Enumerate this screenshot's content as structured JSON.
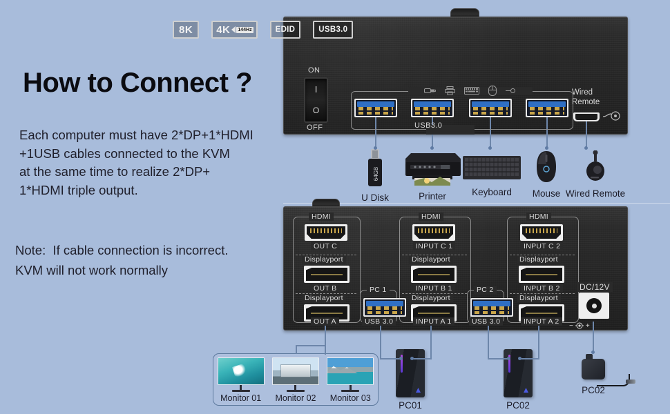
{
  "page": {
    "headline": "How to Connect ?",
    "body": "Each computer must have 2*DP+1*HDMI +1USB cables connected to the KVM at the same time to realize 2*DP+ 1*HDMI triple output.",
    "note": "Note:  If cable connection is incorrect. KVM will not work normally",
    "background_color": "#a8bcdb",
    "text_color": "#20202c"
  },
  "front_panel": {
    "badges": [
      {
        "id": "badge-8k",
        "label": "8K"
      },
      {
        "id": "badge-4k",
        "label": "4K",
        "sub_label": "144Hz"
      },
      {
        "id": "badge-edid",
        "label": "EDID"
      },
      {
        "id": "badge-usb3",
        "label": "USB3.0"
      }
    ],
    "power_switch": {
      "on_label": "ON",
      "off_label": "OFF",
      "on_mark": "I",
      "off_mark": "O"
    },
    "usb_group_label": "USB3.0",
    "usb_ports": [
      {
        "id": "usb-port-1",
        "name": "usb-port-u-disk"
      },
      {
        "id": "usb-port-2",
        "name": "usb-port-printer"
      },
      {
        "id": "usb-port-3",
        "name": "usb-port-keyboard"
      },
      {
        "id": "usb-port-4",
        "name": "usb-port-mouse"
      }
    ],
    "device_icons": [
      "usb-stick-icon",
      "printer-icon",
      "keyboard-icon",
      "mouse-icon"
    ],
    "wired_remote_label": "Wired\nRemote",
    "wired_remote_line1": "Wired",
    "wired_remote_line2": "Remote"
  },
  "rear_panel": {
    "groups": [
      {
        "id": "group-outputs",
        "ports": [
          {
            "type_label": "HDMI",
            "name_label": "OUT C",
            "kind": "hdmi"
          },
          {
            "type_label": "Displayport",
            "name_label": "OUT B",
            "kind": "dp"
          },
          {
            "type_label": "Displayport",
            "name_label": "OUT A",
            "kind": "dp"
          }
        ]
      },
      {
        "id": "group-pc1",
        "pc_label": "PC 1",
        "usb_label": "USB 3.0",
        "ports": [
          {
            "type_label": "HDMI",
            "name_label": "INPUT C 1",
            "kind": "hdmi"
          },
          {
            "type_label": "Displayport",
            "name_label": "INPUT B 1",
            "kind": "dp"
          },
          {
            "type_label": "Displayport",
            "name_label": "INPUT A 1",
            "kind": "dp"
          }
        ]
      },
      {
        "id": "group-pc2",
        "pc_label": "PC 2",
        "usb_label": "USB 3.0",
        "ports": [
          {
            "type_label": "HDMI",
            "name_label": "INPUT C 2",
            "kind": "hdmi"
          },
          {
            "type_label": "Displayport",
            "name_label": "INPUT B 2",
            "kind": "dp"
          },
          {
            "type_label": "Displayport",
            "name_label": "INPUT A 2",
            "kind": "dp"
          }
        ]
      }
    ],
    "power": {
      "label": "DC/12V",
      "negative": "−",
      "positive": "+"
    }
  },
  "peripherals": [
    {
      "id": "u-disk",
      "label": "U Disk",
      "badge": "64GB"
    },
    {
      "id": "printer",
      "label": "Printer"
    },
    {
      "id": "keyboard",
      "label": "Keyboard"
    },
    {
      "id": "mouse",
      "label": "Mouse"
    },
    {
      "id": "wired-remote",
      "label": "Wired Remote"
    }
  ],
  "monitors": [
    {
      "id": "monitor-01",
      "label": "Monitor 01",
      "scene": "wave"
    },
    {
      "id": "monitor-02",
      "label": "Monitor 02",
      "scene": "building"
    },
    {
      "id": "monitor-03",
      "label": "Monitor 03",
      "scene": "mountain"
    }
  ],
  "computers": [
    {
      "id": "pc01",
      "label": "PC01"
    },
    {
      "id": "pc02",
      "label": "PC02"
    }
  ],
  "power_adapter": {
    "label": "PC02"
  }
}
